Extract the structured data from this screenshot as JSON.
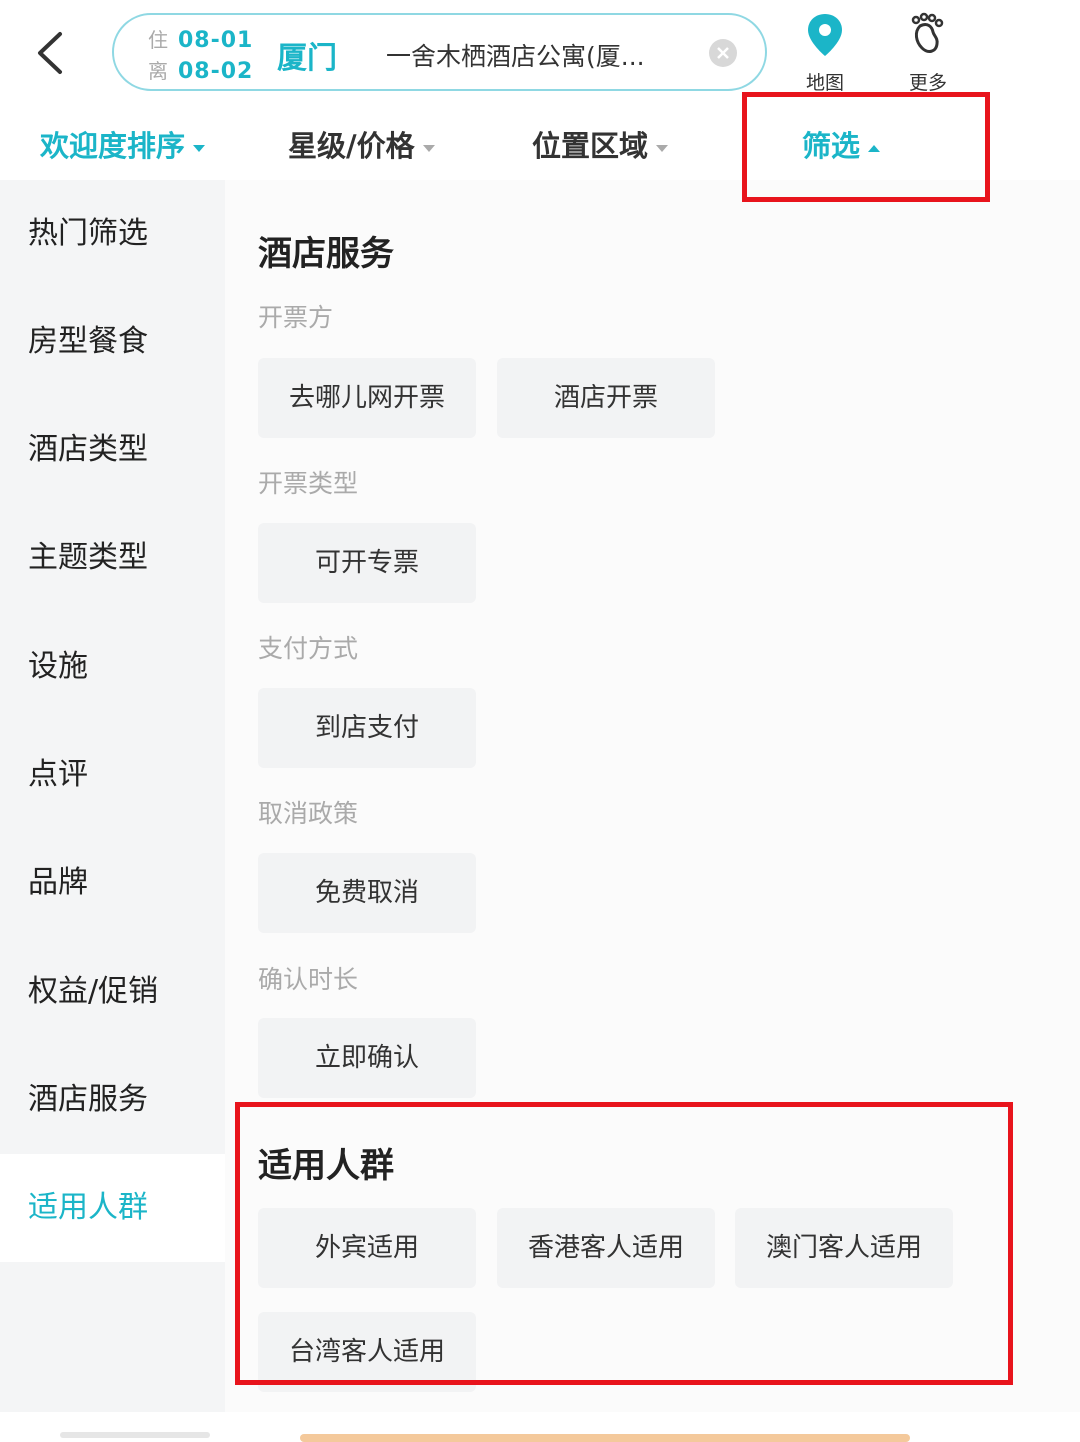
{
  "header": {
    "checkin_label": "住",
    "checkin_date": "08-01",
    "checkout_label": "离",
    "checkout_date": "08-02",
    "city": "厦门",
    "query": "一舍木栖酒店公寓(厦...",
    "map_label": "地图",
    "more_label": "更多",
    "accent_color": "#1bb5c8"
  },
  "sortbar": {
    "items": [
      {
        "label": "欢迎度排序",
        "active": true
      },
      {
        "label": "星级/价格",
        "active": false
      },
      {
        "label": "位置区域",
        "active": false
      },
      {
        "label": "筛选",
        "active": true
      }
    ]
  },
  "sidebar": {
    "items": [
      {
        "label": "热门筛选"
      },
      {
        "label": "房型餐食"
      },
      {
        "label": "酒店类型"
      },
      {
        "label": "主题类型"
      },
      {
        "label": "设施"
      },
      {
        "label": "点评"
      },
      {
        "label": "品牌"
      },
      {
        "label": "权益/促销"
      },
      {
        "label": "酒店服务"
      },
      {
        "label": "适用人群",
        "active": true
      }
    ]
  },
  "content": {
    "hotel_service": {
      "title": "酒店服务",
      "groups": [
        {
          "label": "开票方",
          "options": [
            "去哪儿网开票",
            "酒店开票"
          ]
        },
        {
          "label": "开票类型",
          "options": [
            "可开专票"
          ]
        },
        {
          "label": "支付方式",
          "options": [
            "到店支付"
          ]
        },
        {
          "label": "取消政策",
          "options": [
            "免费取消"
          ]
        },
        {
          "label": "确认时长",
          "options": [
            "立即确认"
          ]
        }
      ]
    },
    "audience": {
      "title": "适用人群",
      "options": [
        "外宾适用",
        "香港客人适用",
        "澳门客人适用",
        "台湾客人适用"
      ]
    }
  },
  "annotation_color": "#e8141c"
}
